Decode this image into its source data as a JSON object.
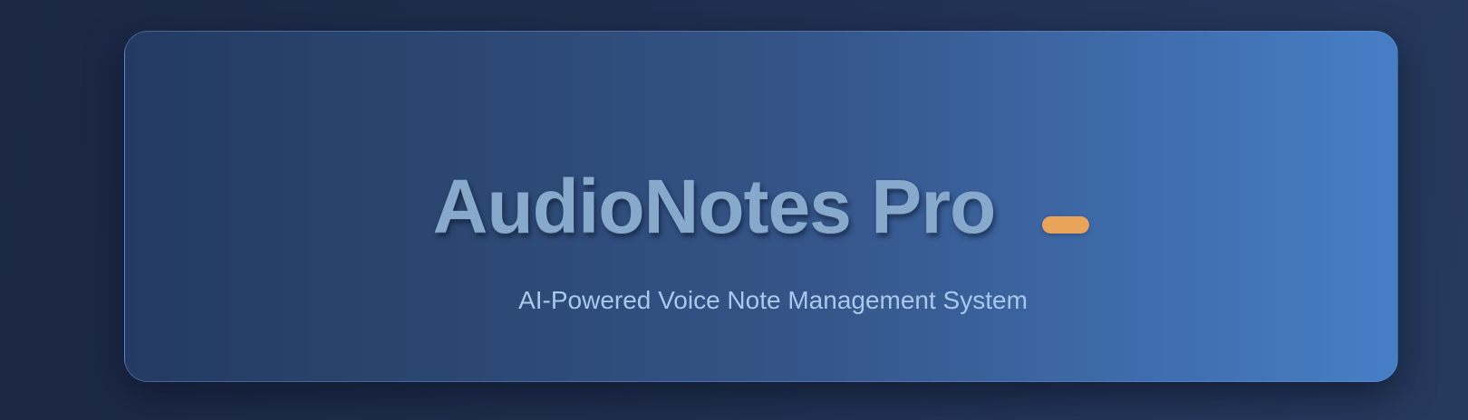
{
  "header": {
    "title": "AudioNotes Pro",
    "subtitle": "AI-Powered Voice Note Management System"
  },
  "colors": {
    "accent": "#e8a45a",
    "title": "#86a9cc",
    "subtitle": "#a8c8ec",
    "card_start": "#233b62",
    "card_end": "#467ec6",
    "background": "#1b2744"
  }
}
